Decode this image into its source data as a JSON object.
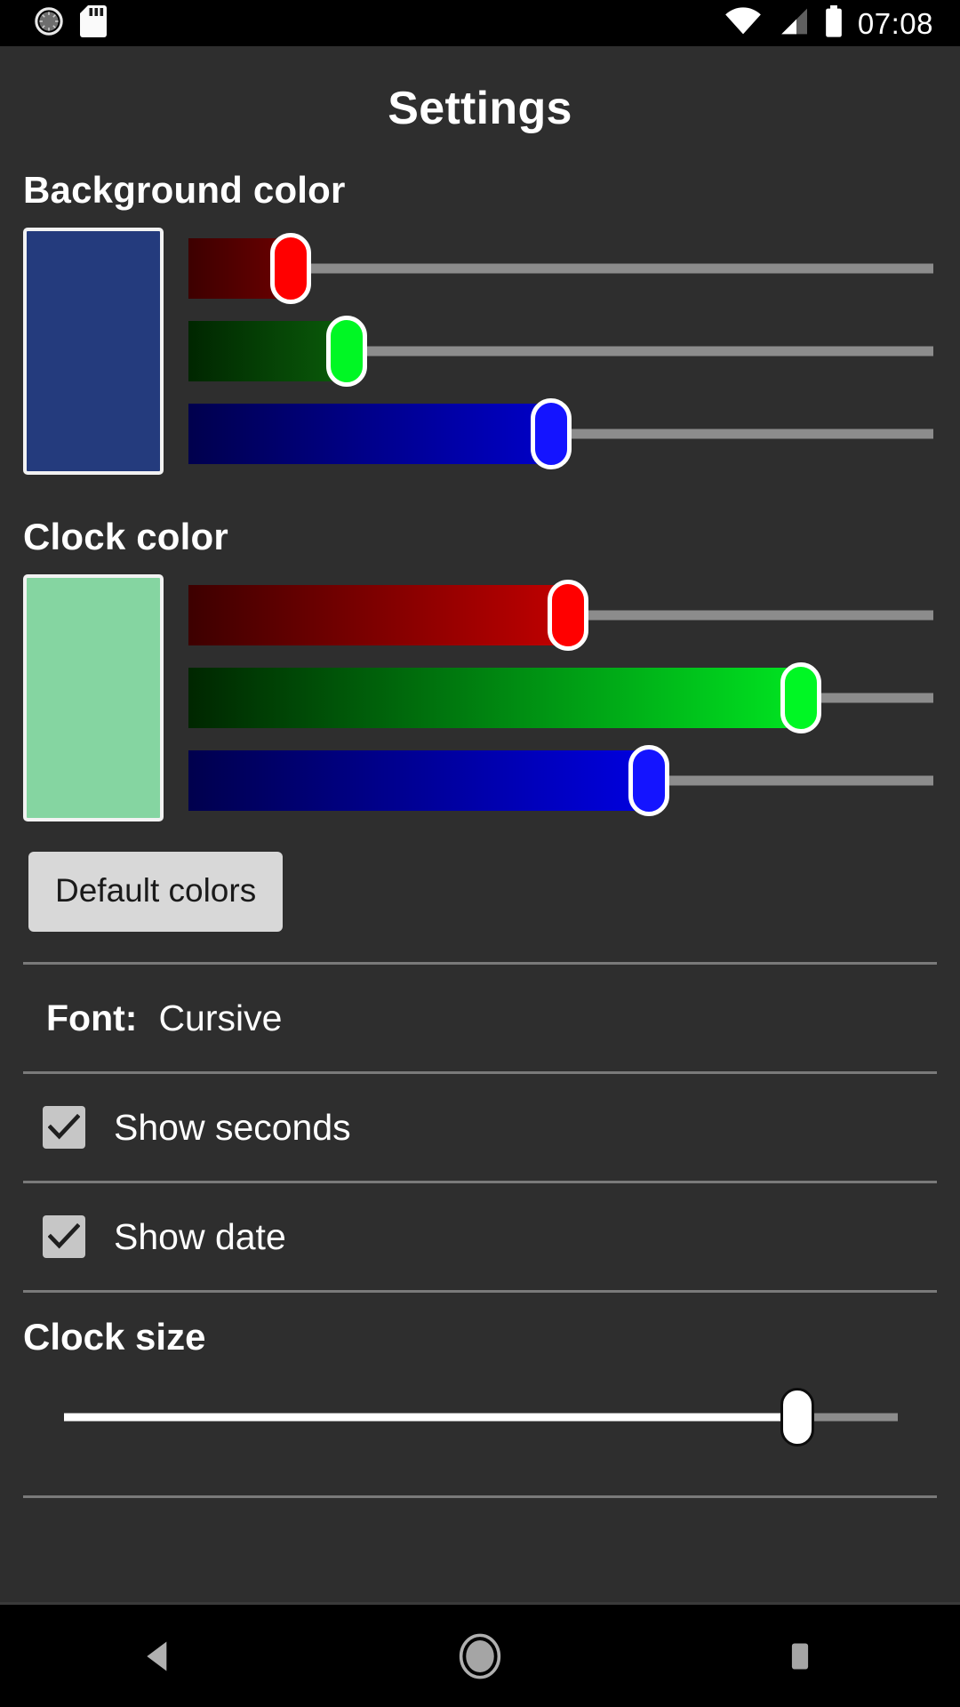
{
  "status_bar": {
    "time": "07:08",
    "icons_left": [
      "sync-spinner-icon",
      "sd-card-icon"
    ],
    "icons_right": [
      "wifi-icon",
      "cell-signal-icon",
      "battery-icon"
    ]
  },
  "header": {
    "title": "Settings"
  },
  "background_color": {
    "heading": "Background color",
    "swatch_hex": "#243b7d",
    "sliders": [
      {
        "channel": "R",
        "value": 35,
        "percent": 13.7,
        "fill_from": "#3d0000",
        "fill_to": "#6b0000",
        "thumb": "#ff0000"
      },
      {
        "channel": "G",
        "value": 59,
        "percent": 21.2,
        "fill_from": "#002600",
        "fill_to": "#0a5c0a",
        "thumb": "#00f724"
      },
      {
        "channel": "B",
        "value": 125,
        "percent": 48.7,
        "fill_from": "#00004d",
        "fill_to": "#0000c8",
        "thumb": "#1414ff"
      }
    ]
  },
  "clock_color": {
    "heading": "Clock color",
    "swatch_hex": "#85d5a1",
    "sliders": [
      {
        "channel": "R",
        "value": 133,
        "percent": 51.0,
        "fill_from": "#3d0000",
        "fill_to": "#c10000",
        "thumb": "#ff0000"
      },
      {
        "channel": "G",
        "value": 213,
        "percent": 82.2,
        "fill_from": "#002600",
        "fill_to": "#00e521",
        "thumb": "#00f724"
      },
      {
        "channel": "B",
        "value": 161,
        "percent": 61.8,
        "fill_from": "#00004d",
        "fill_to": "#0000e0",
        "thumb": "#1414ff"
      }
    ]
  },
  "default_button": {
    "label": "Default colors"
  },
  "font_row": {
    "label": "Font:",
    "value": "Cursive"
  },
  "checkboxes": [
    {
      "label": "Show seconds",
      "checked": true
    },
    {
      "label": "Show date",
      "checked": true
    }
  ],
  "clock_size": {
    "heading": "Clock size",
    "percent": 88,
    "track_filled_hex": "#ffffff",
    "track_remaining_hex": "#8c8c8c",
    "thumb_hex": "#ffffff"
  },
  "nav_bar": {
    "buttons": [
      "back-button",
      "home-button",
      "recents-button"
    ]
  },
  "theme": {
    "page_background": "#2e2e2e",
    "status_bar_background": "#000000",
    "text_primary": "#ffffff",
    "divider": "#7a7a7a"
  }
}
